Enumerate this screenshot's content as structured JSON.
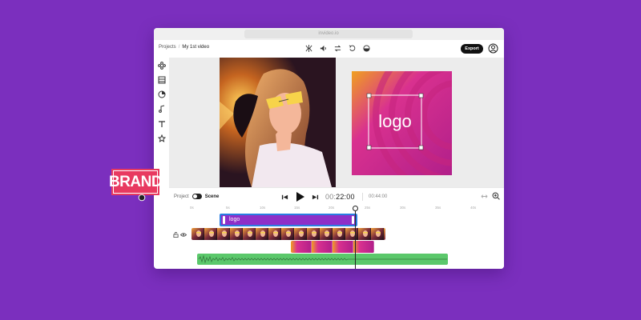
{
  "window": {
    "url": "invideo.io"
  },
  "header": {
    "breadcrumb": {
      "root": "Projects",
      "current": "My 1st video"
    },
    "export_label": "Export"
  },
  "toolbar_icons": [
    "split-icon",
    "volume-icon",
    "swap-icon",
    "undo-icon",
    "color-filter-icon"
  ],
  "sidebar_icons": [
    "layout-icon",
    "media-icon",
    "sticker-icon",
    "music-icon",
    "text-icon",
    "star-icon"
  ],
  "canvas": {
    "logo_text": "logo"
  },
  "timeline": {
    "mode_left": "Project",
    "mode_right": "Scene",
    "current_time": {
      "hours": "00:",
      "rest": "22:00"
    },
    "total_time": "00:44:00",
    "ruler_ticks": [
      "0s",
      "5s",
      "10s",
      "15s",
      "20s",
      "25s",
      "30s",
      "35s",
      "40s"
    ],
    "logo_clip_label": "logo"
  },
  "overlay": {
    "brand_text": "BRAND"
  },
  "colors": {
    "background": "#7b2fbe",
    "logo_track": "#8e2fc7",
    "selection": "#2a7de1",
    "audio_track": "#5bc86b",
    "brand_badge": "#e83a60"
  }
}
